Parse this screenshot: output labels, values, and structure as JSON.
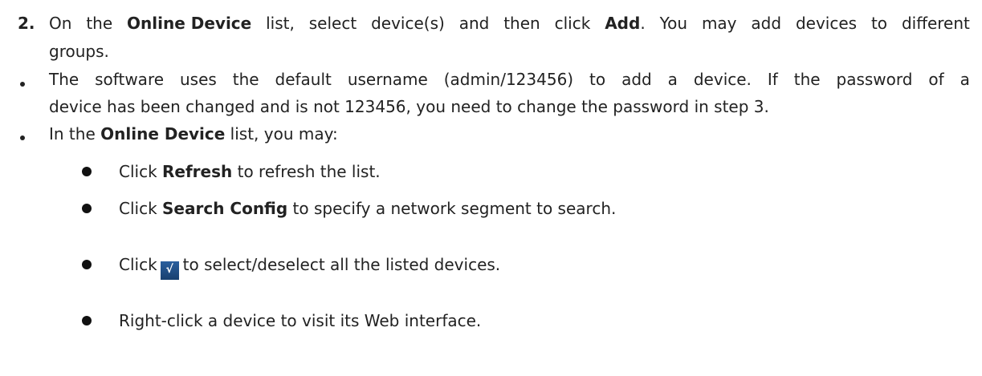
{
  "step": {
    "number": "2.",
    "line1_words": [
      "On",
      "the",
      "Online Device",
      "list,",
      "select",
      "device(s)",
      "and",
      "then",
      "click",
      "Add.",
      "You",
      "may",
      "add",
      "devices",
      "to",
      "different"
    ],
    "line2": "groups."
  },
  "bullets": [
    {
      "line1_words": [
        "The",
        "software",
        "uses",
        "the",
        "default",
        "username",
        "(admin/123456)",
        "to",
        "add",
        "a",
        "device.",
        "If",
        "the",
        "password",
        "of",
        "a"
      ],
      "line2": "device has been changed and is not 123456, you need to change the password in step 3."
    },
    {
      "prefix": "In the ",
      "bold": "Online Device",
      "suffix": " list, you may:"
    }
  ],
  "sub_bullets": [
    {
      "prefix": "Click ",
      "bold": "Refresh",
      "suffix": " to refresh the list."
    },
    {
      "prefix": "Click ",
      "bold": "Search Config",
      "suffix": " to specify a network segment to search."
    },
    {
      "prefix": "Click",
      "icon": "check-icon",
      "icon_glyph": "√",
      "suffix": "to select/deselect all the listed devices."
    },
    {
      "prefix": "Right-click a device to visit its Web interface.",
      "bold": "",
      "suffix": ""
    }
  ]
}
